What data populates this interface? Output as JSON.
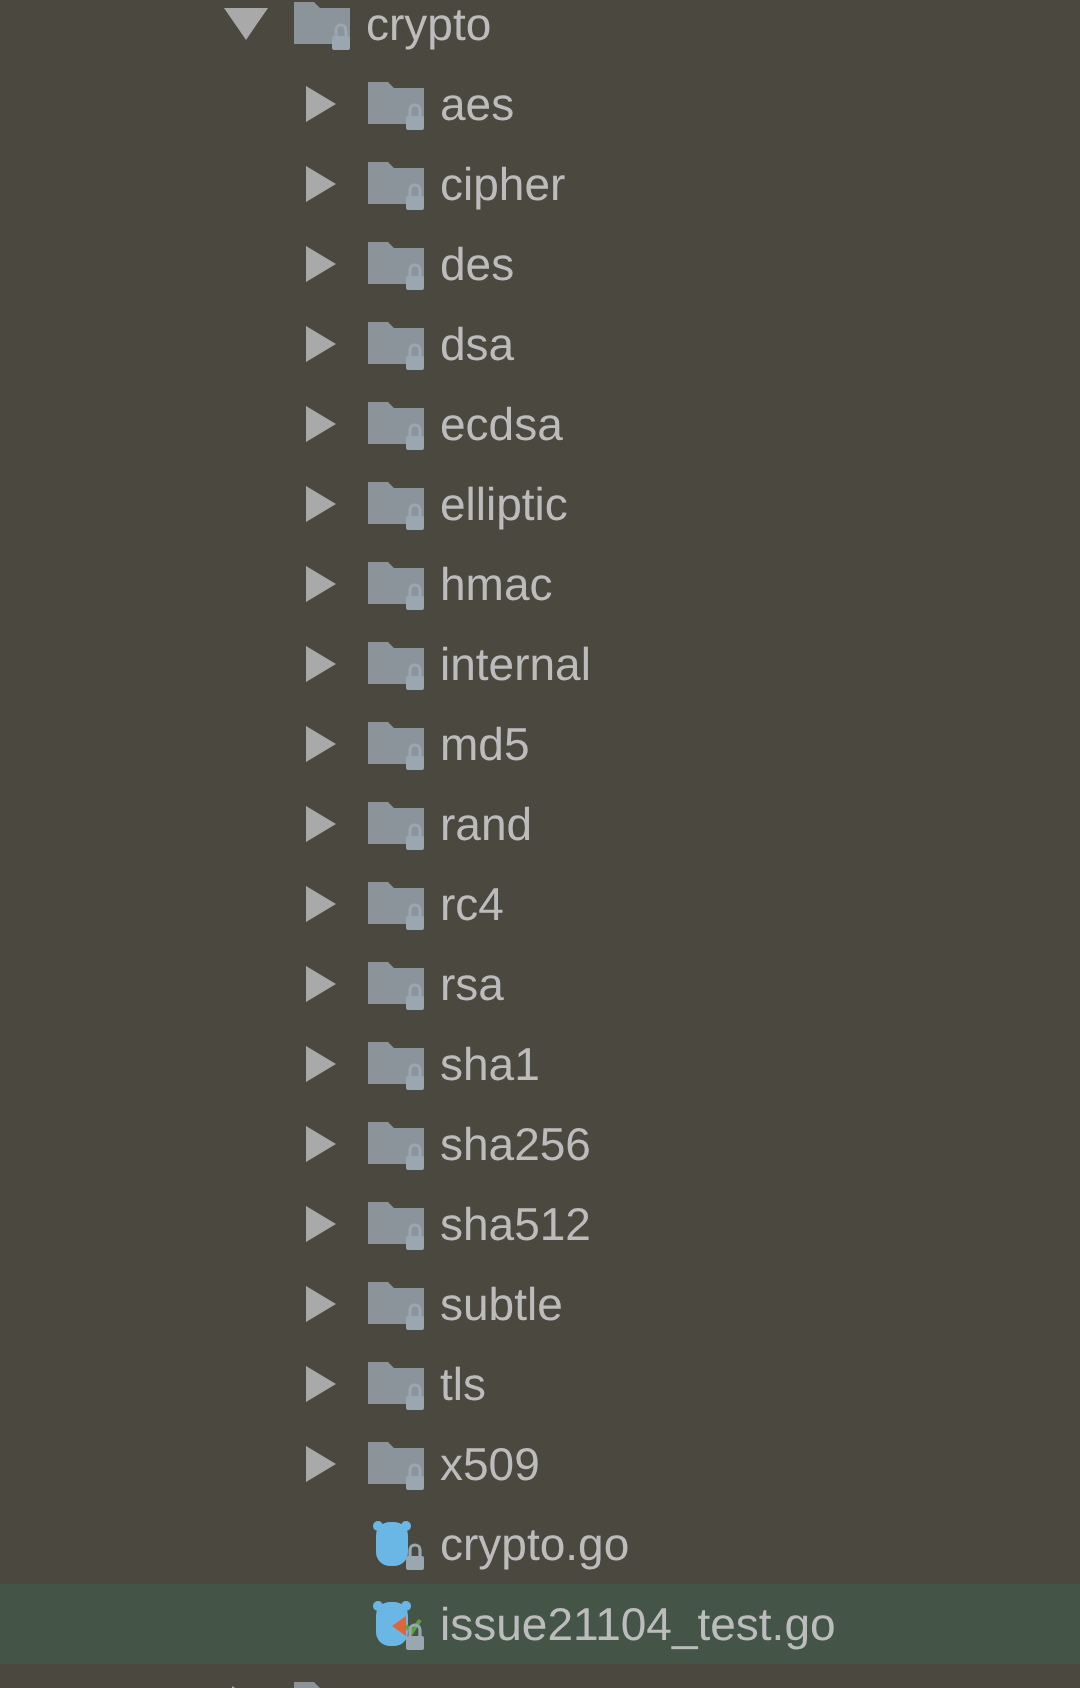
{
  "tree": [
    {
      "kind": "folder",
      "name": "crypto",
      "expanded": true,
      "selected": false,
      "children": [
        {
          "kind": "folder",
          "name": "aes",
          "expanded": false,
          "selected": false
        },
        {
          "kind": "folder",
          "name": "cipher",
          "expanded": false,
          "selected": false
        },
        {
          "kind": "folder",
          "name": "des",
          "expanded": false,
          "selected": false
        },
        {
          "kind": "folder",
          "name": "dsa",
          "expanded": false,
          "selected": false
        },
        {
          "kind": "folder",
          "name": "ecdsa",
          "expanded": false,
          "selected": false
        },
        {
          "kind": "folder",
          "name": "elliptic",
          "expanded": false,
          "selected": false
        },
        {
          "kind": "folder",
          "name": "hmac",
          "expanded": false,
          "selected": false
        },
        {
          "kind": "folder",
          "name": "internal",
          "expanded": false,
          "selected": false
        },
        {
          "kind": "folder",
          "name": "md5",
          "expanded": false,
          "selected": false
        },
        {
          "kind": "folder",
          "name": "rand",
          "expanded": false,
          "selected": false
        },
        {
          "kind": "folder",
          "name": "rc4",
          "expanded": false,
          "selected": false
        },
        {
          "kind": "folder",
          "name": "rsa",
          "expanded": false,
          "selected": false
        },
        {
          "kind": "folder",
          "name": "sha1",
          "expanded": false,
          "selected": false
        },
        {
          "kind": "folder",
          "name": "sha256",
          "expanded": false,
          "selected": false
        },
        {
          "kind": "folder",
          "name": "sha512",
          "expanded": false,
          "selected": false
        },
        {
          "kind": "folder",
          "name": "subtle",
          "expanded": false,
          "selected": false
        },
        {
          "kind": "folder",
          "name": "tls",
          "expanded": false,
          "selected": false
        },
        {
          "kind": "folder",
          "name": "x509",
          "expanded": false,
          "selected": false
        },
        {
          "kind": "go-file",
          "name": "crypto.go",
          "selected": false
        },
        {
          "kind": "test-file",
          "name": "issue21104_test.go",
          "selected": true
        }
      ]
    },
    {
      "kind": "folder",
      "expanded": false,
      "selected": false
    }
  ]
}
